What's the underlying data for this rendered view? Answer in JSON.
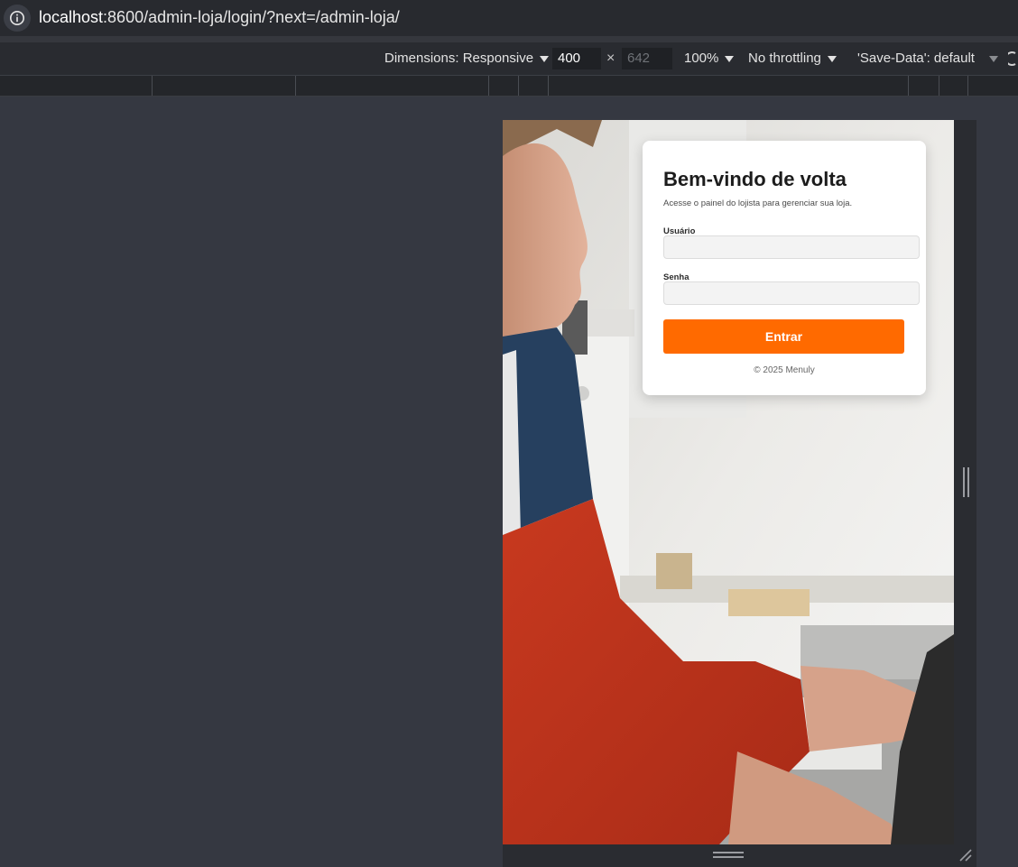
{
  "browser": {
    "url_host": "localhost",
    "url_rest": ":8600/admin-loja/login/?next=/admin-loja/"
  },
  "device_toolbar": {
    "dimensions_label": "Dimensions: Responsive",
    "width": "400",
    "times": "×",
    "height": "642",
    "zoom": "100%",
    "throttling": "No throttling",
    "save_data": "'Save-Data': default"
  },
  "login": {
    "title": "Bem-vindo de volta",
    "subtitle": "Acesse o painel do lojista para gerenciar sua loja.",
    "username_label": "Usuário",
    "password_label": "Senha",
    "submit_label": "Entrar",
    "footer": "© 2025 Menuly"
  },
  "colors": {
    "accent": "#ff6a00",
    "page_bg": "#353841"
  }
}
